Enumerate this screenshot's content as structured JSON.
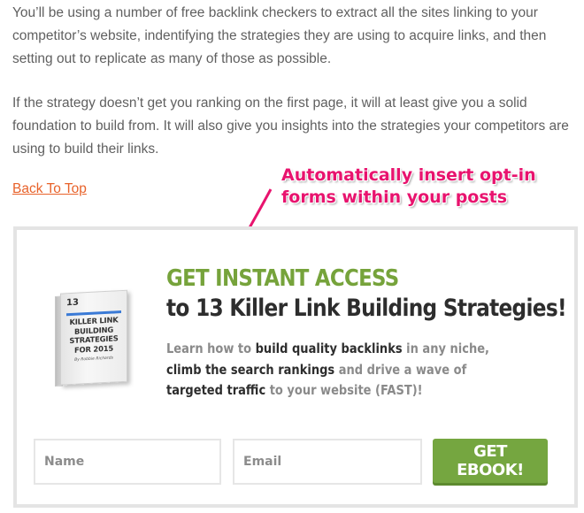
{
  "article": {
    "paragraph_1": "You’ll be using a number of free backlink checkers to extract all the sites linking to your competitor’s website, indentifying the strategies they are using to acquire links, and then setting out to replicate as many of those as possible.",
    "paragraph_2": "If the strategy doesn’t get you ranking on the first page, it will at least give you a solid foundation to build from. It will also give you insights into the strategies your competitors are using to build their links.",
    "back_to_top": "Back To Top"
  },
  "annotation": {
    "line_1": "Automatically insert opt-in",
    "line_2": "forms within your posts"
  },
  "optin": {
    "book": {
      "number": "13",
      "title_lines": [
        "KILLER LINK",
        "BUILDING",
        "STRATEGIES",
        "FOR 2015"
      ],
      "author": "By Robbie Richards"
    },
    "headline_green": "GET INSTANT ACCESS",
    "headline_dark": "to 13 Killer Link Building Strategies!",
    "description": {
      "t1": "Learn how to ",
      "b1": "build quality backlinks",
      "t2": " in any niche, ",
      "b2": "climb the search rankings",
      "t3": " and drive a wave of ",
      "b3": "targeted traffic",
      "t4": " to your website (FAST)!"
    },
    "name_placeholder": "Name",
    "email_placeholder": "Email",
    "button_label": "GET EBOOK!"
  },
  "colors": {
    "accent_green": "#76a33b",
    "annotation_pink": "#e8136e",
    "link_orange": "#e8622a"
  }
}
